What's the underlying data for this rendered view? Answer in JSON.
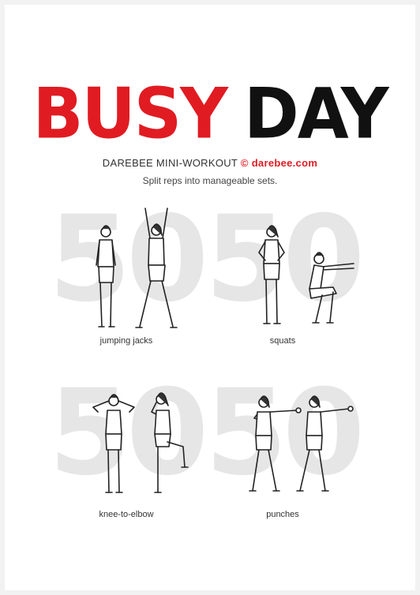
{
  "header": {
    "title_word1": "BUSY",
    "title_word2": "DAY",
    "brand": "DAREBEE MINI-WORKOUT",
    "copyright_symbol": "©",
    "site": "darebee.com",
    "instructions": "Split reps into manageable sets.",
    "accent_color": "#e11b22",
    "dark_color": "#111111"
  },
  "exercises": [
    {
      "reps": "50",
      "name": "jumping jacks",
      "icon": "jumping-jacks-figure"
    },
    {
      "reps": "50",
      "name": "squats",
      "icon": "squats-figure"
    },
    {
      "reps": "50",
      "name": "knee-to-elbow",
      "icon": "knee-to-elbow-figure"
    },
    {
      "reps": "50",
      "name": "punches",
      "icon": "punches-figure"
    }
  ]
}
